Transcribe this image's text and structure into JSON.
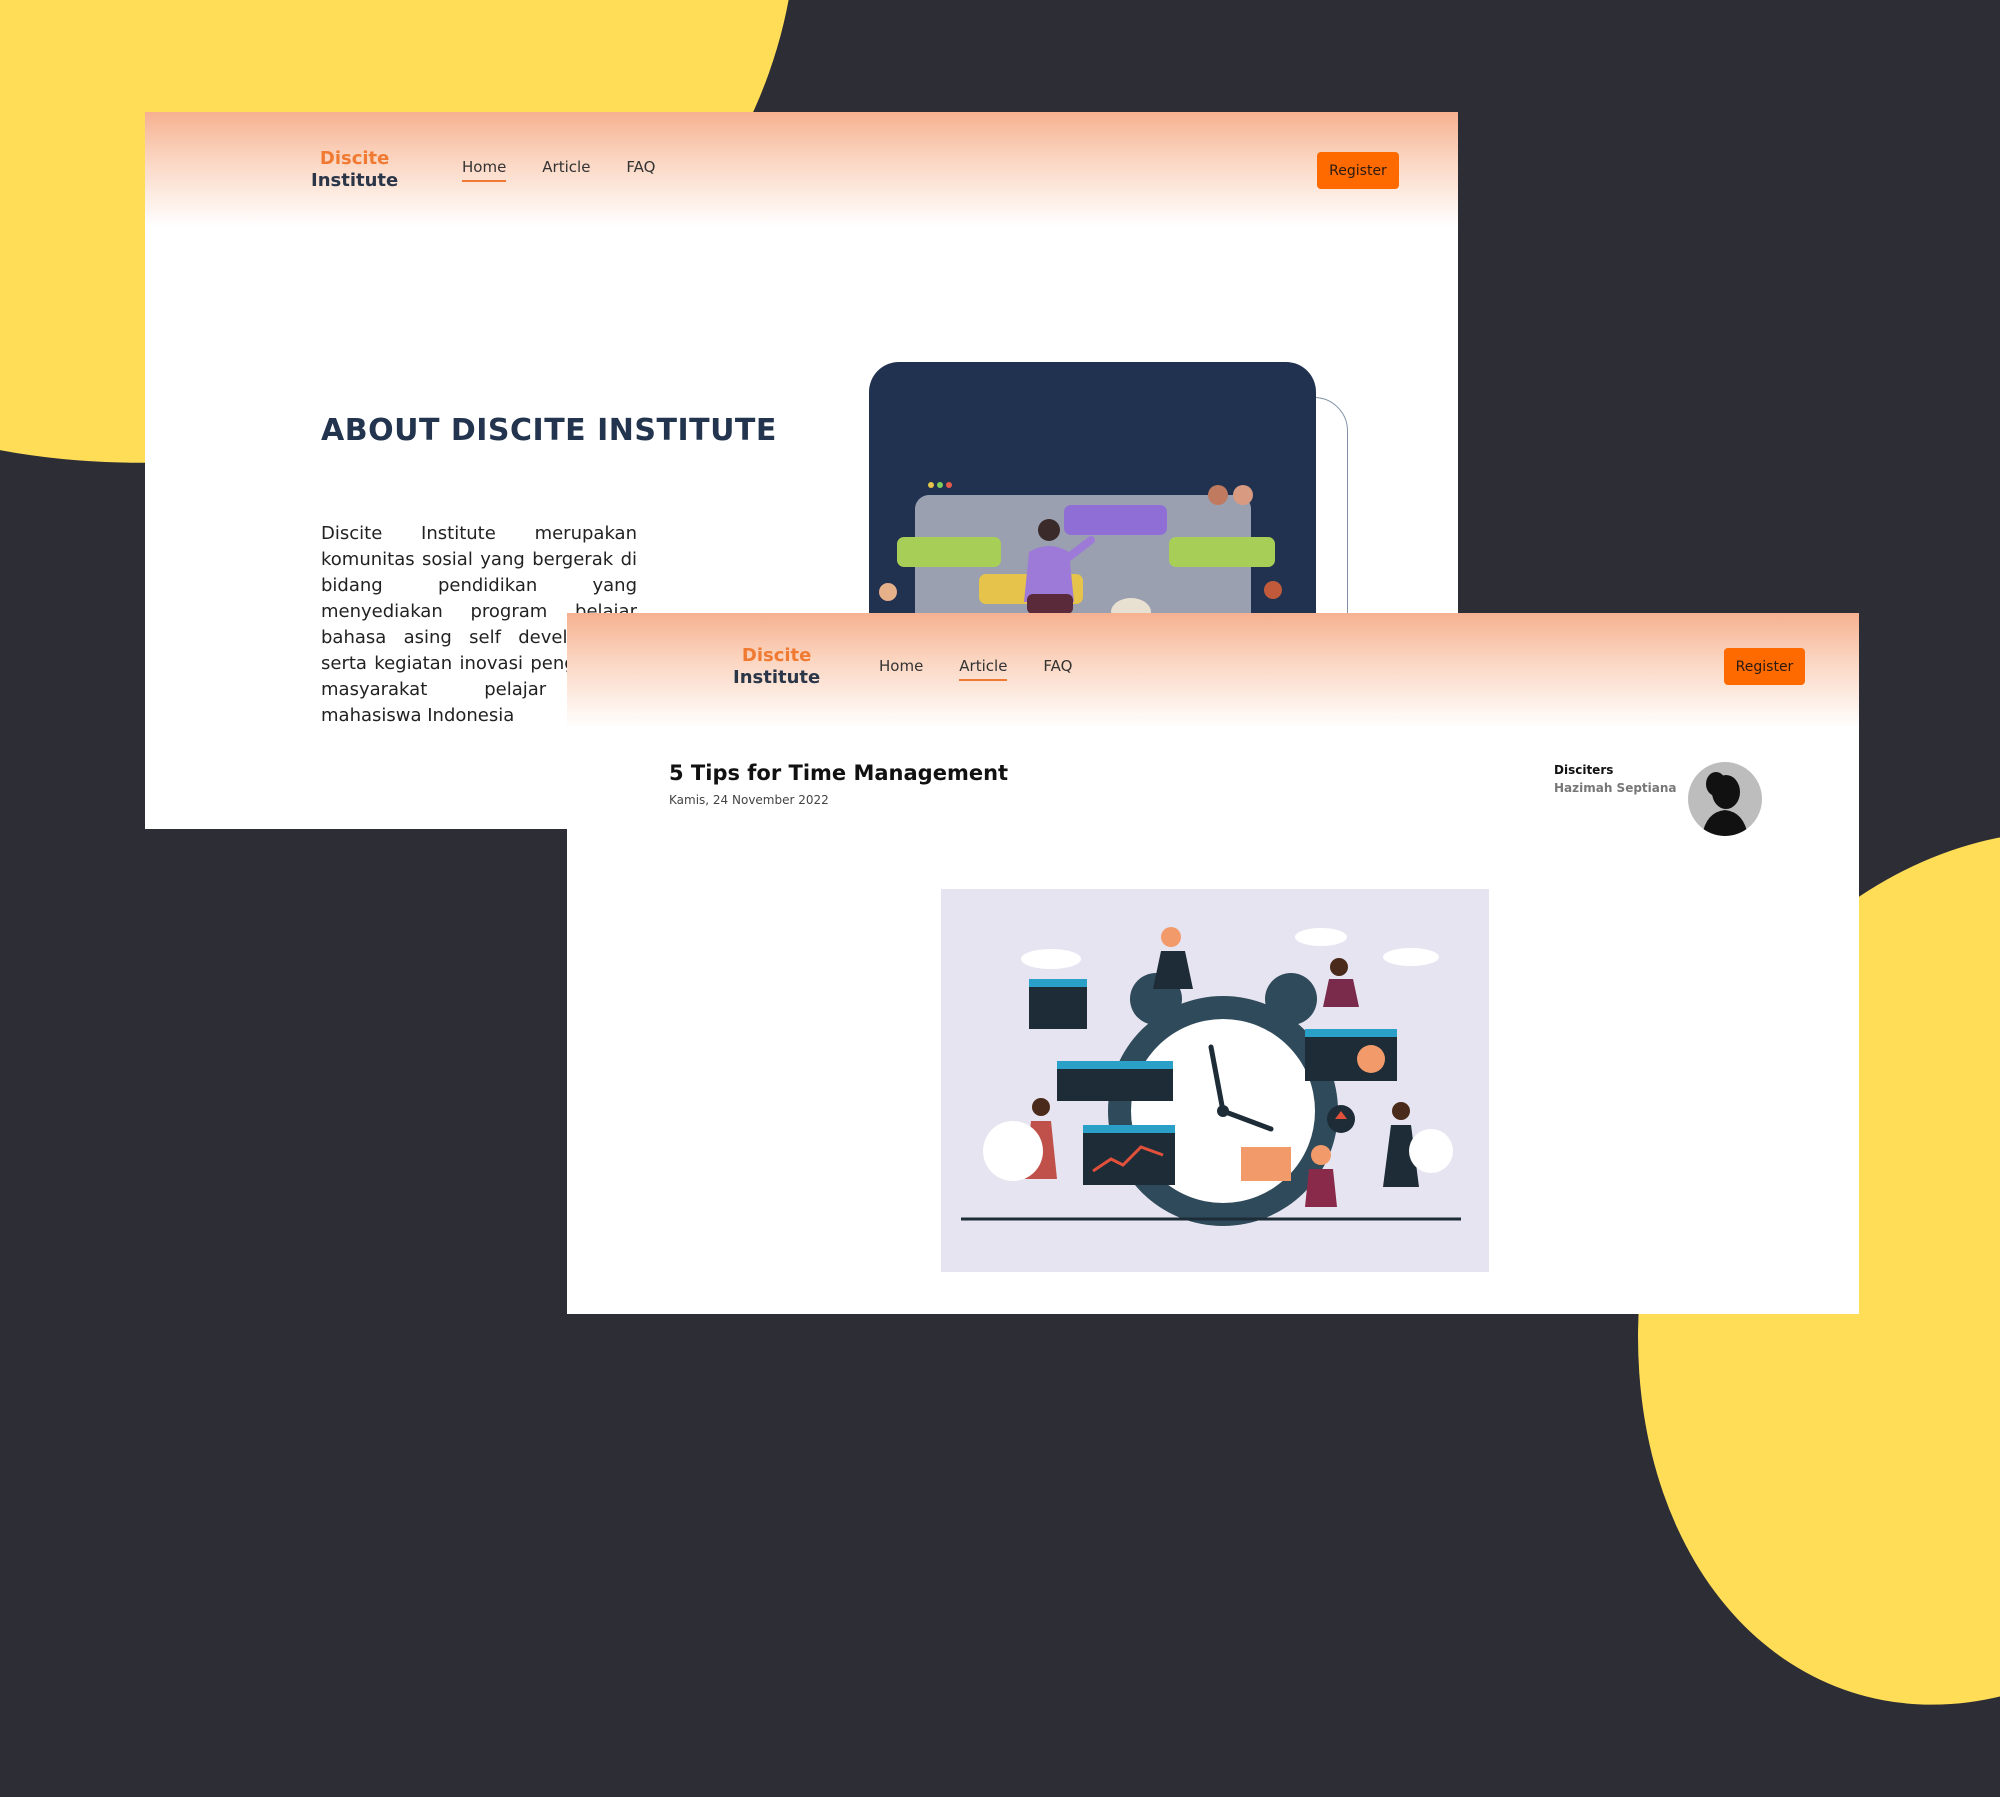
{
  "colors": {
    "background": "#2c2d35",
    "accent_yellow": "#ffdd57",
    "brand_orange": "#f07a32",
    "button_orange": "#ff6a00",
    "navy": "#213250"
  },
  "page1": {
    "logo": {
      "line1": "Discite",
      "line2": "Institute"
    },
    "nav": {
      "home": "Home",
      "article": "Article",
      "faq": "FAQ",
      "active": "Home"
    },
    "register_label": "Register",
    "about": {
      "title": "ABOUT DISCITE INSTITUTE",
      "text": "Discite Institute merupakan komunitas sosial yang bergerak di bidang pendidikan yang menyediakan program belajar bahasa asing self development serta kegiatan inovasi pengabdian masyarakat pelajar dan mahasiswa Indonesia"
    },
    "hero_icon": "people-building-ui-blocks-illustration"
  },
  "page2": {
    "logo": {
      "line1": "Discite",
      "line2": "Institute"
    },
    "nav": {
      "home": "Home",
      "article": "Article",
      "faq": "FAQ",
      "active": "Article"
    },
    "register_label": "Register",
    "article": {
      "title": "5 Tips for Time Management",
      "date": "Kamis, 24 November 2022",
      "author_label": "Disciters",
      "author_name": "Hazimah Septiana",
      "image_icon": "alarm-clock-teamwork-illustration"
    }
  }
}
